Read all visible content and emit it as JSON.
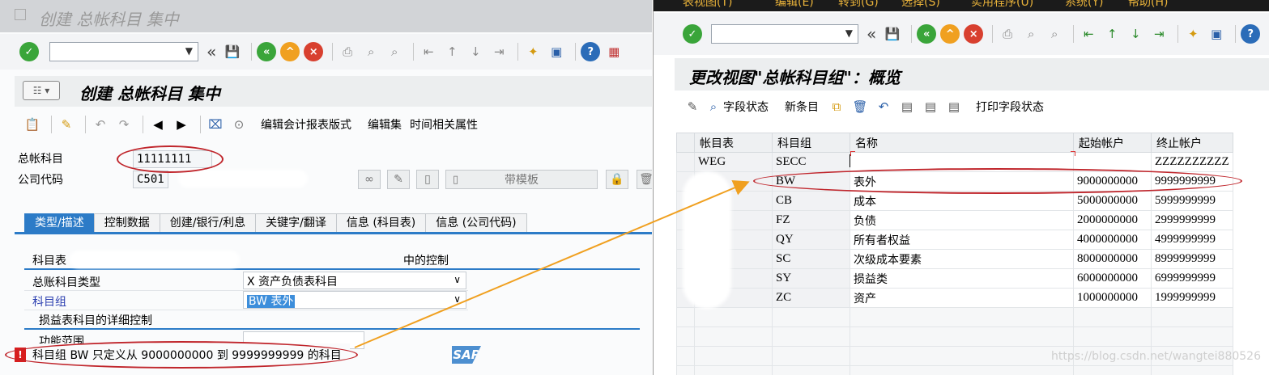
{
  "left": {
    "window_title": "创建 总帐科目 集中",
    "screen_title": "创建 总帐科目 集中",
    "app_toolbar": {
      "edit_fs_version": "编辑会计报表版式",
      "edit_set": "编辑集",
      "time_dependent": "时间相关属性"
    },
    "gl_account_label": "总帐科目",
    "gl_account_value": "11111111",
    "company_code_label": "公司代码",
    "company_code_value": "C501",
    "with_template_button": "带模板",
    "tabs": [
      "类型/描述",
      "控制数据",
      "创建/银行/利息",
      "关键字/翻译",
      "信息 (科目表)",
      "信息 (公司代码)"
    ],
    "coa_label": "科目表",
    "control_in_label": "中的控制",
    "account_type_label": "总账科目类型",
    "account_type_value": "X 资产负债表科目",
    "account_group_label": "科目组",
    "account_group_value": "BW 表外",
    "pl_detail_label": "损益表科目的详细控制",
    "functional_area_label": "功能范围",
    "status_message": "科目组 BW 只定义从 9000000000 到 9999999999 的科目",
    "sap_logo": "SAP"
  },
  "right": {
    "menu_items": [
      "表视图(T)",
      "编辑(E)",
      "转到(G)",
      "选择(S)",
      "实用程序(U)",
      "系统(Y)",
      "帮助(H)"
    ],
    "screen_title": "更改视图\"总帐科目组\"：概览",
    "app_toolbar": {
      "field_status": "字段状态",
      "new_entries": "新条目",
      "print_field_status": "打印字段状态"
    },
    "table": {
      "headers": [
        "帐目表",
        "科目组",
        "名称",
        "起始帐户",
        "终止帐户"
      ],
      "rows": [
        {
          "coa": "WEG",
          "group": "SECC",
          "name": "",
          "from": "",
          "to": "ZZZZZZZZZZ"
        },
        {
          "coa": "",
          "group": "BW",
          "name": "表外",
          "from": "9000000000",
          "to": "9999999999"
        },
        {
          "coa": "",
          "group": "CB",
          "name": "成本",
          "from": "5000000000",
          "to": "5999999999"
        },
        {
          "coa": "",
          "group": "FZ",
          "name": "负债",
          "from": "2000000000",
          "to": "2999999999"
        },
        {
          "coa": "",
          "group": "QY",
          "name": "所有者权益",
          "from": "4000000000",
          "to": "4999999999"
        },
        {
          "coa": "",
          "group": "SC",
          "name": "次级成本要素",
          "from": "8000000000",
          "to": "8999999999"
        },
        {
          "coa": "",
          "group": "SY",
          "name": "损益类",
          "from": "6000000000",
          "to": "6999999999"
        },
        {
          "coa": "",
          "group": "ZC",
          "name": "资产",
          "from": "1000000000",
          "to": "1999999999"
        }
      ]
    },
    "watermark": "https://blog.csdn.net/wangtei880526"
  },
  "colors": {
    "accent_blue": "#2c7bc7",
    "annotation_red": "#c0262c",
    "arrow_orange": "#f0a020",
    "error_red": "#d81e1e"
  }
}
